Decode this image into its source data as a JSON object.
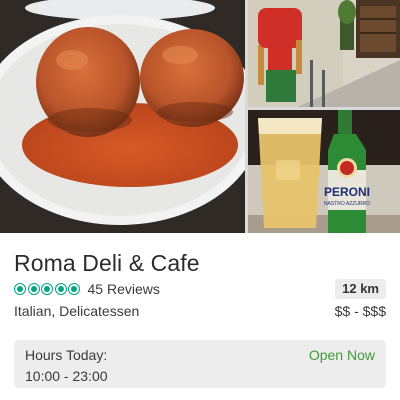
{
  "restaurant": {
    "name": "Roma Deli & Cafe",
    "rating_bubbles": 5,
    "reviews": "45 Reviews",
    "distance": "12 km",
    "cuisine": "Italian, Delicatessen",
    "price_range": "$$ - $$$"
  },
  "hours": {
    "label": "Hours Today:",
    "value": "10:00 - 23:00",
    "status": "Open Now"
  },
  "photos": {
    "beer_brand_top": "PERONI",
    "beer_brand_sub": "NASTRO AZZURRO"
  },
  "colors": {
    "rating_green": "#00a680",
    "open_green": "#3f9d3a",
    "hours_bg": "#ededed",
    "distance_bg": "#ececec"
  }
}
